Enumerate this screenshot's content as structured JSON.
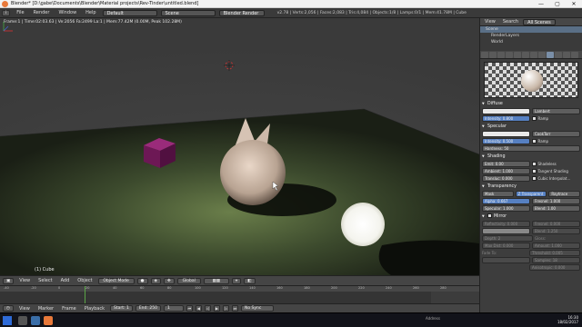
{
  "titlebar": {
    "title": "Blender* [D:\\gabe\\Documents\\Blender\\Material projects\\Rev-Tinder\\untitled.blend]",
    "min": "—",
    "max": "▢",
    "close": "✕"
  },
  "infobar": {
    "menus": [
      "File",
      "Render",
      "Window",
      "Help"
    ],
    "layout": "Default",
    "scene": "Scene",
    "engine": "Blender Render",
    "stats": "v2.78 | Verts:2,056 | Faces:2,083 | Tris:4,084 | Objects:1/8 | Lamps:0/1 | Mem:41.78M | Cube"
  },
  "viewport": {
    "info": "Frame:1 | Time:02:03.63 | Ve:2056 Fa:2499 La:1 | Mem:77.42M (0.00M, Peak 102.28M)",
    "object_label": "(1) Cube"
  },
  "viewtools": {
    "items": [
      "View",
      "Select",
      "Add",
      "Object"
    ],
    "mode": "Object Mode",
    "pivot": "Global"
  },
  "timeline": {
    "ticks": [
      "-40",
      "-20",
      "0",
      "20",
      "40",
      "60",
      "80",
      "100",
      "120",
      "140",
      "160",
      "180",
      "200",
      "220",
      "240",
      "260",
      "280"
    ],
    "controls": [
      "View",
      "Marker",
      "Frame",
      "Playback"
    ],
    "start": "Start:",
    "start_val": "1",
    "end": "End:",
    "end_val": "250",
    "current": "1",
    "sync": "No Sync"
  },
  "outliner": {
    "view": "View",
    "search": "Search",
    "scenes": "All Scenes",
    "rows": [
      "Scene",
      "RenderLayers",
      "World"
    ]
  },
  "properties": {
    "diffuse": {
      "header": "Diffuse",
      "shader": "Lambert",
      "intensity": "Intensity: 0.800",
      "ramp": "Ramp"
    },
    "specular": {
      "header": "Specular",
      "shader": "CookTorr",
      "intensity": "Intensity: 0.500",
      "ramp": "Ramp",
      "hardness": "Hardness:",
      "hardness_val": "50"
    },
    "shading": {
      "header": "Shading",
      "emit": "Emit:",
      "emit_val": "0.00",
      "ambient": "Ambient:",
      "ambient_val": "1.000",
      "translucency": "Transluc:",
      "translucency_val": "0.000",
      "shadeless": "Shadeless",
      "tangent": "Tangent Shading",
      "cubic": "Cubic Interpolat..."
    },
    "transparency": {
      "header": "Transparency",
      "mask": "Mask",
      "ztransp": "Z Transparent",
      "raytrace": "Raytrace",
      "alpha": "Alpha:",
      "alpha_val": "0.667",
      "fresnel": "Fresnel:",
      "fresnel_val": "1.000",
      "specular": "Specular:",
      "specular_val": "1.000",
      "blend": "Blend:",
      "blend_val": "1.00"
    },
    "mirror": {
      "header": "Mirror",
      "reflect": "Reflectivity: 0.000",
      "fresnel": "Fresnel: 0.000",
      "blend": "Blend: 1.250",
      "depth": "Depth: 2",
      "maxdist": "Max Dist: 0.000",
      "fadeto": "Fade To:",
      "gloss": "Gloss:",
      "amount": "Amount: 1.000",
      "threshold": "Threshold: 0.005",
      "samples": "Samples: 18",
      "aniso": "Anisotropic: 0.000"
    }
  },
  "taskbar": {
    "address": "Address",
    "time": "16:30",
    "date": "18/02/2017"
  },
  "colors": {
    "accent": "#5680c2",
    "floor": "#3e4a30",
    "cube": "#7a1f5e"
  }
}
